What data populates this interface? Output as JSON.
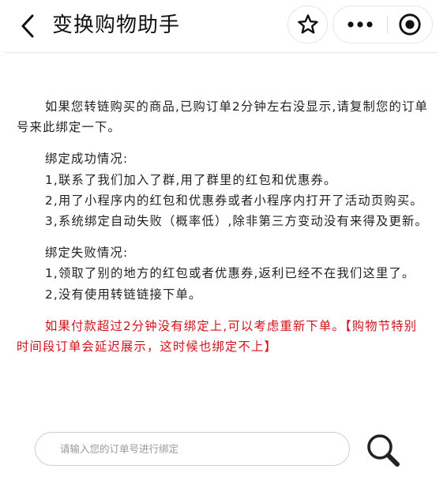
{
  "navbar": {
    "back_icon": "chevron-left-icon",
    "title": "变换购物助手",
    "favorite_icon": "star-icon",
    "more_icon": "more-dots-icon",
    "close_icon": "target-close-icon"
  },
  "content": {
    "intro": "如果您转链购买的商品,已购订单2分钟左右没显示,请复制您的订单号来此绑定一下。",
    "success": {
      "heading": "绑定成功情况:",
      "items": [
        "1,联系了我们加入了群,用了群里的红包和优惠券。",
        "2,用了小程序内的红包和优惠券或者小程序内打开了活动页购买。",
        "3,系统绑定自动失败（概率低）,除非第三方变动没有来得及更新。"
      ]
    },
    "failure": {
      "heading": "绑定失败情况:",
      "items": [
        "1,领取了别的地方的红包或者优惠券,返利已经不在我们这里了。",
        "2,没有使用转链链接下单。"
      ]
    },
    "notice": "如果付款超过2分钟没有绑定上,可以考虑重新下单。【购物节特别时间段订单会延迟展示，这时候也绑定不上】"
  },
  "search": {
    "placeholder": "请输入您的订单号进行绑定",
    "value": "",
    "icon": "search-icon"
  },
  "colors": {
    "notice_red": "#d0121b",
    "text": "#222222",
    "border": "#cfcfcf"
  }
}
